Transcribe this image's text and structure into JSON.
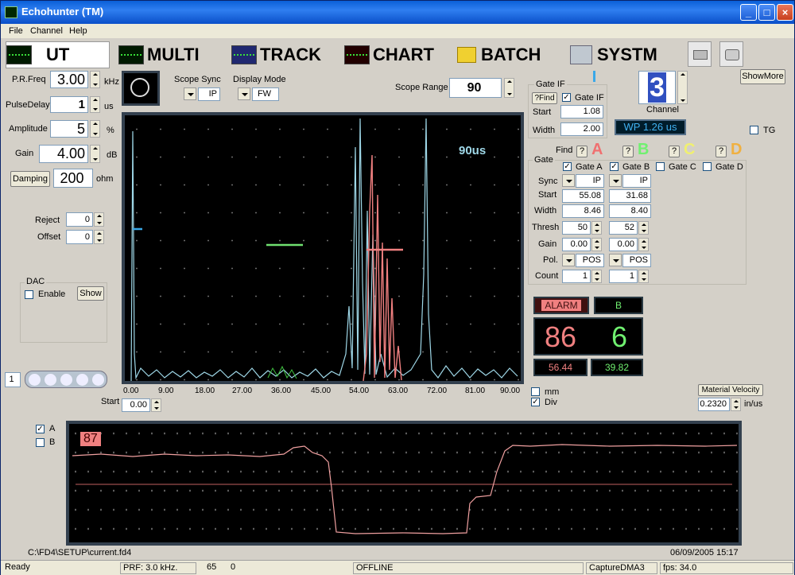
{
  "window": {
    "title": "Echohunter (TM)"
  },
  "menu": [
    "File",
    "Channel",
    "Help"
  ],
  "tabs": [
    "UT",
    "MULTI",
    "TRACK",
    "CHART",
    "BATCH",
    "SYSTM"
  ],
  "pulser": {
    "prf_label": "P.R.Freq",
    "prf_value": "3.00",
    "prf_unit": "kHz",
    "delay_label": "PulseDelay",
    "delay_value": "1",
    "delay_unit": "us",
    "amp_label": "Amplitude",
    "amp_value": "5",
    "amp_unit": "%",
    "gain_label": "Gain",
    "gain_value": "4.00",
    "gain_unit": "dB",
    "damping_button": "Damping",
    "damping_value": "200",
    "damping_unit": "ohm",
    "reject_label": "Reject",
    "reject_value": "0",
    "offset_label": "Offset",
    "offset_value": "0"
  },
  "dac": {
    "title": "DAC",
    "enable_label": "Enable",
    "show_button": "Show"
  },
  "scope": {
    "sync_label": "Scope Sync",
    "sync_value": "IP",
    "mode_label": "Display Mode",
    "mode_value": "FW",
    "range_label": "Scope Range",
    "range_value": "90",
    "overlay": "90us",
    "xticks": [
      "0.00",
      "9.00",
      "18.00",
      "27.00",
      "36.00",
      "45.00",
      "54.00",
      "63.00",
      "72.00",
      "81.00",
      "90.00"
    ],
    "start_label": "Start",
    "start_value": "0.00",
    "mm_label": "mm",
    "div_label": "Div",
    "channel_page": "1"
  },
  "gate_if": {
    "title": "Gate IF",
    "find_button": "?Find",
    "check_label": "Gate IF",
    "start_label": "Start",
    "start_value": "1.08",
    "width_label": "Width",
    "width_value": "2.00",
    "wp_text": "WP  1.26 us"
  },
  "channel": {
    "value": "3",
    "label": "Channel"
  },
  "showmore_button": "ShowMore",
  "tg_label": "TG",
  "gates": {
    "title": "Gate",
    "find_label": "Find",
    "letters": [
      "A",
      "B",
      "C",
      "D"
    ],
    "letter_colors": [
      "#f07070",
      "#70f070",
      "#f0f070",
      "#f0b040"
    ],
    "checks": [
      "Gate A",
      "Gate B",
      "Gate C",
      "Gate D"
    ],
    "rows": [
      "Sync",
      "Start",
      "Width",
      "Thresh",
      "Gain",
      "Pol.",
      "Count"
    ],
    "a": [
      "IP",
      "55.08",
      "8.46",
      "50",
      "0.00",
      "POS",
      "1"
    ],
    "b": [
      "IP",
      "31.68",
      "8.40",
      "52",
      "0.00",
      "POS",
      "1"
    ]
  },
  "readout": {
    "alarm": "ALARM",
    "alarm_gate": "B",
    "amp_a": "86",
    "amp_b": "6",
    "tof_a": "56.44",
    "tof_b": "39.82"
  },
  "velocity": {
    "button": "Material Velocity",
    "value": "0.2320",
    "unit": "in/us"
  },
  "strip": {
    "a_label": "A",
    "b_label": "B",
    "value": "87"
  },
  "file": {
    "path": "C:\\FD4\\SETUP\\current.fd4",
    "datetime": "06/09/2005 15:17"
  },
  "status": {
    "ready": "Ready",
    "prf": "PRF: 3.0 kHz.",
    "n1": "65",
    "n2": "0",
    "mode": "OFFLINE",
    "capture": "CaptureDMA3",
    "fps": "fps: 34.0"
  },
  "colors": {
    "trace_blue": "#9fd8e8",
    "gate_red": "#f08080",
    "gate_green": "#70e070",
    "strip_trace": "#f0a0a0"
  }
}
